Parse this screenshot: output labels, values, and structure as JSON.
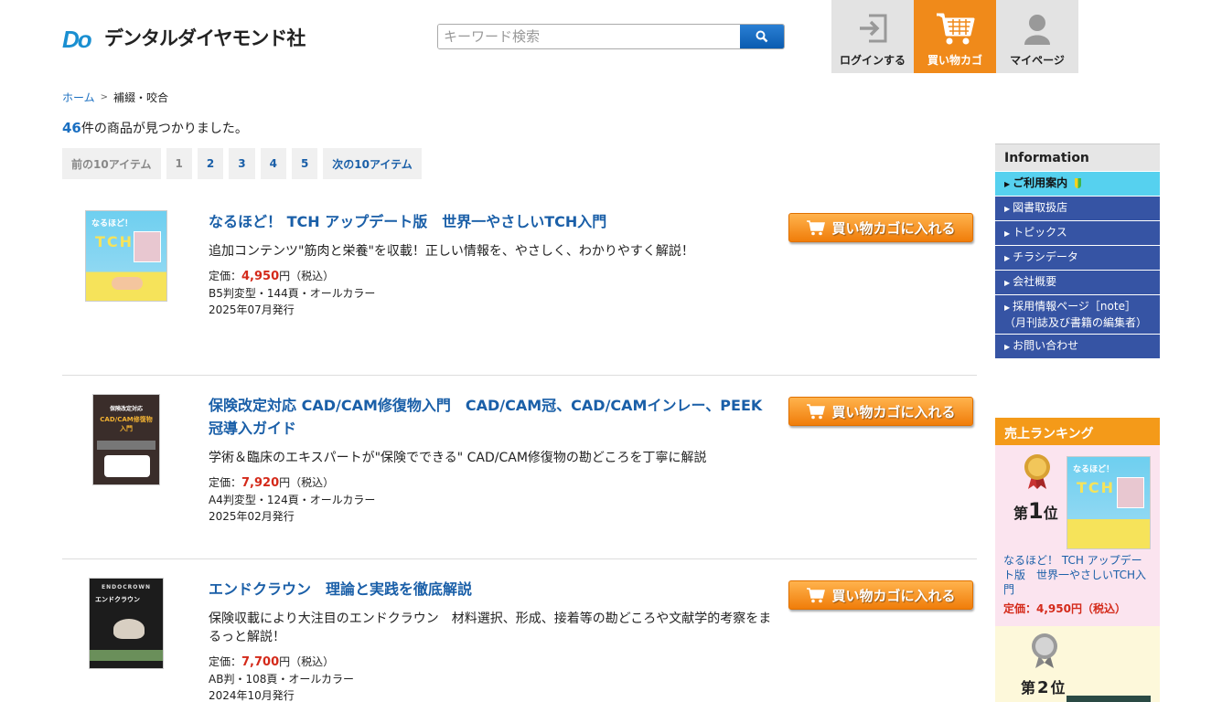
{
  "header": {
    "logo_mark": "Do",
    "logo_text": "デンタルダイヤモンド社",
    "search_placeholder": "キーワード検索",
    "nav": [
      {
        "label": "ログインする",
        "icon": "login-icon"
      },
      {
        "label": "買い物カゴ",
        "icon": "cart-icon"
      },
      {
        "label": "マイページ",
        "icon": "user-icon"
      }
    ]
  },
  "breadcrumb": {
    "home": "ホーム",
    "separator": ">",
    "current": "補綴・咬合"
  },
  "result": {
    "count": "46",
    "suffix": "件の商品が見つかりました。"
  },
  "pager": {
    "prev": "前の10アイテム",
    "pages": [
      "1",
      "2",
      "3",
      "4",
      "5"
    ],
    "next": "次の10アイテム"
  },
  "add_to_cart_label": "買い物カゴに入れる",
  "products": [
    {
      "title": "なるほど！ TCH アップデート版　世界一やさしいTCH入門",
      "desc": "追加コンテンツ\"筋肉と栄養\"を収載！正しい情報を、やさしく、わかりやすく解説！",
      "price_label": "定価：",
      "price": "4,950",
      "price_suffix": "円（税込）",
      "format": "B5判変型・144頁・オールカラー",
      "date": "2025年07月発行"
    },
    {
      "title": "保険改定対応 CAD/CAM修復物入門　CAD/CAM冠、CAD/CAMインレー、PEEK冠導入ガイド",
      "desc": "学術＆臨床のエキスパートが\"保険でできる\" CAD/CAM修復物の勘どころを丁寧に解説",
      "price_label": "定価：",
      "price": "7,920",
      "price_suffix": "円（税込）",
      "format": "A4判変型・124頁・オールカラー",
      "date": "2025年02月発行"
    },
    {
      "title": "エンドクラウン　理論と実践を徹底解説",
      "desc": "保険収載により大注目のエンドクラウン　材料選択、形成、接着等の勘どころや文献学的考察をまるっと解説！",
      "price_label": "定価：",
      "price": "7,700",
      "price_suffix": "円（税込）",
      "format": "AB判・108頁・オールカラー",
      "date": "2024年10月発行"
    }
  ],
  "covers": {
    "c1_top": "なるほど！",
    "c1_letters": "TCH",
    "c2_title": "CAD/CAM修復物入門",
    "c2_top": "保険改定対応",
    "c3_brand": "ENDOCROWN",
    "c3_title": "エンドクラウン"
  },
  "sidebar": {
    "heading": "Information",
    "items": [
      "ご利用案内",
      "図書取扱店",
      "トピックス",
      "チラシデータ",
      "会社概要",
      "採用情報ページ［note］\n（月刊誌及び書籍の編集者）",
      "お問い合わせ"
    ]
  },
  "ranking": {
    "heading": "売上ランキング",
    "first": {
      "prefix": "第",
      "rank": "1",
      "suffix": "位",
      "title": "なるほど！ TCH アップデート版　世界一やさしいTCH入門",
      "price": "定価：4,950円（税込）"
    },
    "second": {
      "prefix": "第",
      "rank": "2",
      "suffix": "位"
    }
  },
  "colors": {
    "accent": "#1a5fa8",
    "cart_orange": "#f08a1a",
    "price_red": "#d42a1a",
    "sidebar_blue": "#3654a4"
  }
}
